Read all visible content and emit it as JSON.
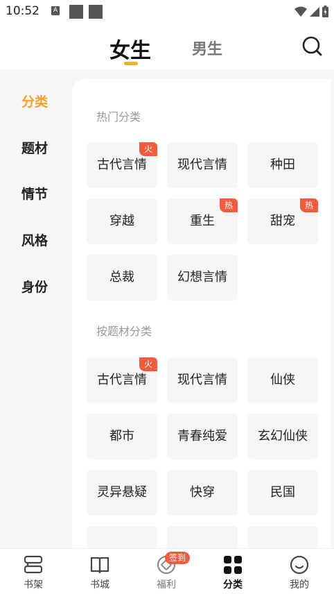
{
  "status_bar": {
    "time": "10:52",
    "a_icon": "A"
  },
  "header": {
    "tabs": [
      {
        "label": "女生",
        "active": true
      },
      {
        "label": "男生",
        "active": false
      }
    ]
  },
  "sidebar": {
    "items": [
      {
        "label": "分类",
        "active": true
      },
      {
        "label": "题材",
        "active": false
      },
      {
        "label": "情节",
        "active": false
      },
      {
        "label": "风格",
        "active": false
      },
      {
        "label": "身份",
        "active": false
      }
    ]
  },
  "sections": [
    {
      "title": "热门分类",
      "tags": [
        {
          "label": "古代言情",
          "badge": "火"
        },
        {
          "label": "现代言情",
          "badge": ""
        },
        {
          "label": "种田",
          "badge": ""
        },
        {
          "label": "穿越",
          "badge": ""
        },
        {
          "label": "重生",
          "badge": "热"
        },
        {
          "label": "甜宠",
          "badge": "热"
        },
        {
          "label": "总裁",
          "badge": ""
        },
        {
          "label": "幻想言情",
          "badge": ""
        }
      ]
    },
    {
      "title": "按题材分类",
      "tags": [
        {
          "label": "古代言情",
          "badge": "火"
        },
        {
          "label": "现代言情",
          "badge": ""
        },
        {
          "label": "仙侠",
          "badge": ""
        },
        {
          "label": "都市",
          "badge": ""
        },
        {
          "label": "青春纯爱",
          "badge": ""
        },
        {
          "label": "玄幻仙侠",
          "badge": ""
        },
        {
          "label": "灵异悬疑",
          "badge": ""
        },
        {
          "label": "快穿",
          "badge": ""
        },
        {
          "label": "民国",
          "badge": ""
        }
      ]
    }
  ],
  "bottom_nav": {
    "items": [
      {
        "label": "书架",
        "icon": "bookshelf-icon"
      },
      {
        "label": "书城",
        "icon": "book-icon"
      },
      {
        "label": "福利",
        "icon": "coupon-icon",
        "badge": "签到"
      },
      {
        "label": "分类",
        "icon": "grid-icon",
        "active": true
      },
      {
        "label": "我的",
        "icon": "smile-icon"
      }
    ]
  },
  "colors": {
    "accent": "#f2a22a",
    "underline": "#f4b400",
    "badge": "#f25b3f"
  }
}
